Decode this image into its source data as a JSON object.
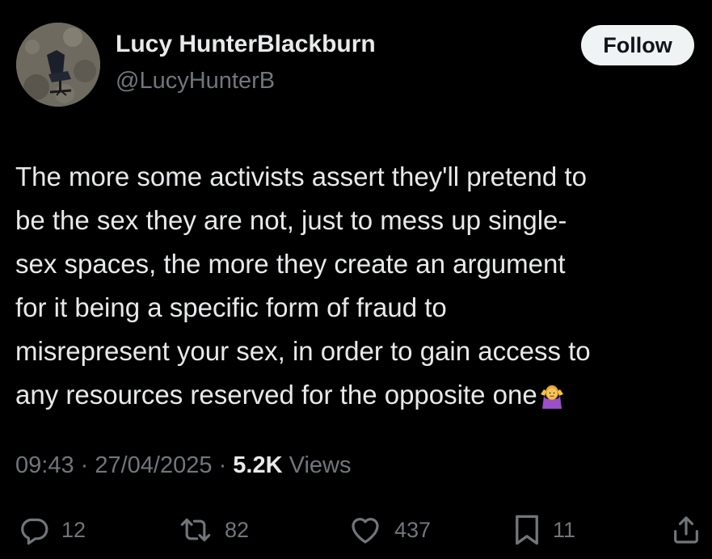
{
  "author": {
    "display_name": "Lucy HunterBlackburn",
    "handle": "@LucyHunterB"
  },
  "follow_label": "Follow",
  "tweet": {
    "lines": [
      "The more some activists assert they'll pretend to",
      "be the sex they are not, just to mess up single-",
      "sex spaces, the more they create an argument",
      "for it being a specific form of fraud to",
      "misrepresent your sex, in order to gain access to",
      "any resources reserved for the opposite one"
    ],
    "trailing_emoji": "person-shrugging-emoji"
  },
  "meta": {
    "time": "09:43",
    "separator": " · ",
    "date": "27/04/2025",
    "views_count": "5.2K",
    "views_label": " Views"
  },
  "actions": {
    "replies": "12",
    "reposts": "82",
    "likes": "437",
    "bookmarks": "11"
  },
  "icons": {
    "reply": "reply-icon",
    "repost": "repost-icon",
    "like": "heart-icon",
    "bookmark": "bookmark-icon",
    "share": "share-icon"
  },
  "colors": {
    "background": "#000000",
    "primary_text": "#e7e9ea",
    "secondary_text": "#71767b",
    "follow_button_bg": "#eff3f4",
    "follow_button_text": "#0f1419"
  }
}
